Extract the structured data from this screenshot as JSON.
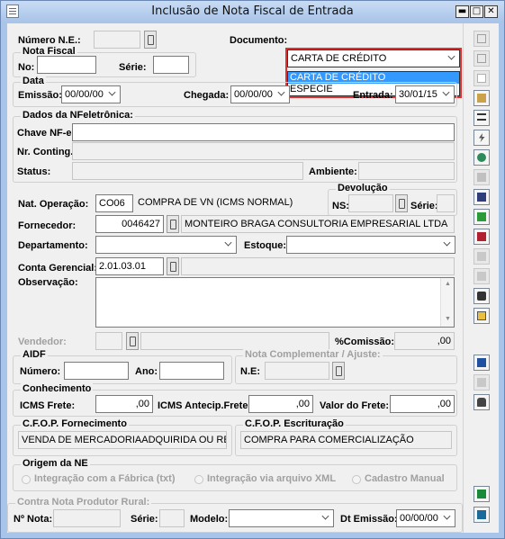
{
  "window": {
    "title": "Inclusão de Nota Fiscal de Entrada"
  },
  "header": {
    "numero_ne_label": "Número N.E.:",
    "numero_ne_value": "",
    "documento_label": "Documento:",
    "documento_value": "CARTA DE CRÉDITO",
    "documento_options": [
      "CARTA DE CRÉDITO",
      "ESPECIE"
    ]
  },
  "nota_fiscal": {
    "title": "Nota Fiscal",
    "no_label": "No:",
    "no_value": "",
    "serie_label": "Série:",
    "serie_value": ""
  },
  "data": {
    "title": "Data",
    "emissao_label": "Emissão:",
    "emissao_value": "00/00/00",
    "chegada_label": "Chegada:",
    "chegada_value": "00/00/00",
    "entrada_label": "Entrada:",
    "entrada_value": "30/01/15"
  },
  "nfe": {
    "title": "Dados da NFeletrônica:",
    "chave_label": "Chave NF-e:",
    "chave_value": "",
    "contingencia_label": "Nr. Conting.:",
    "contingencia_value": "",
    "status_label": "Status:",
    "status_value": "",
    "ambiente_label": "Ambiente:",
    "ambiente_value": ""
  },
  "operacao": {
    "label": "Nat. Operação:",
    "code": "CO06",
    "description": "COMPRA DE VN (ICMS NORMAL)"
  },
  "devolucao": {
    "title": "Devolução",
    "ns_label": "NS:",
    "ns_value": "",
    "serie_label": "Série:",
    "serie_value": ""
  },
  "fornecedor": {
    "label": "Fornecedor:",
    "code": "0046427",
    "name": "MONTEIRO BRAGA CONSULTORIA EMPRESARIAL LTDA"
  },
  "departamento": {
    "label": "Departamento:",
    "value": ""
  },
  "estoque": {
    "label": "Estoque:",
    "value": ""
  },
  "conta": {
    "label": "Conta Gerencial:",
    "code": "2.01.03.01",
    "description": ""
  },
  "observacao": {
    "label": "Observação:",
    "value": ""
  },
  "vendedor": {
    "label": "Vendedor:",
    "code": "",
    "name": "",
    "comissao_label": "%Comissão:",
    "comissao_value": ",00"
  },
  "aidf": {
    "title": "AIDF",
    "numero_label": "Número:",
    "numero_value": "",
    "ano_label": "Ano:",
    "ano_value": ""
  },
  "complementar": {
    "title": "Nota Complementar / Ajuste:",
    "ne_label": "N.E:",
    "ne_value": ""
  },
  "conhecimento": {
    "title": "Conhecimento",
    "icms_frete_label": "ICMS Frete:",
    "icms_frete_value": ",00",
    "icms_antecip_label": "ICMS Antecip.Frete:",
    "icms_antecip_value": ",00",
    "valor_frete_label": "Valor do Frete:",
    "valor_frete_value": ",00"
  },
  "cfop": {
    "fornecimento_title": "C.F.O.P. Fornecimento",
    "fornecimento_value": "VENDA DE MERCADORIAADQUIRIDA OU RE",
    "escrituracao_title": "C.F.O.P. Escrituração",
    "escrituracao_value": "COMPRA PARA COMERCIALIZAÇÃO"
  },
  "origem": {
    "title": "Origem da NE",
    "options": [
      "Integração com a Fábrica (txt)",
      "Integração via arquivo XML",
      "Cadastro Manual"
    ]
  },
  "produtor": {
    "title": "Contra Nota Produtor Rural:",
    "nota_label": "Nº Nota:",
    "nota_value": "",
    "serie_label": "Série:",
    "serie_value": "",
    "modelo_label": "Modelo:",
    "modelo_value": "",
    "emissao_label": "Dt Emissão:",
    "emissao_value": "00/00/00"
  }
}
